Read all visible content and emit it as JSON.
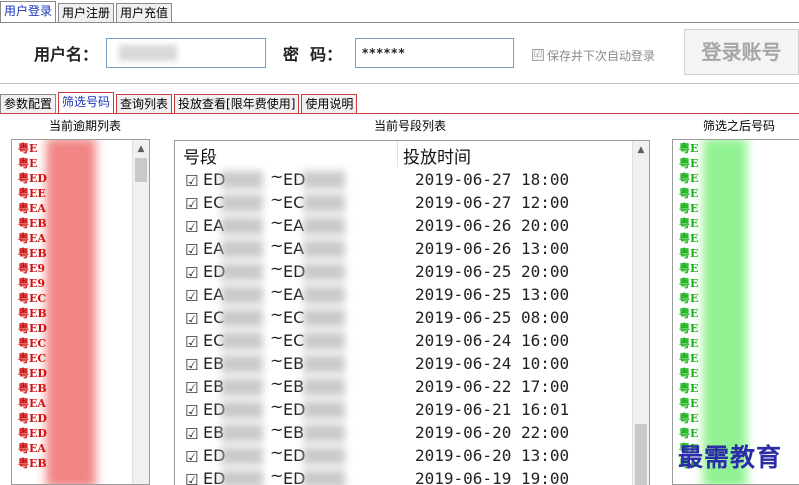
{
  "top_tabs": [
    "用户登录",
    "用户注册",
    "用户充值"
  ],
  "login": {
    "username_label": "用户名：",
    "username_value": "",
    "password_label": "密  码：",
    "password_value": "******",
    "remember_label": "保存并下次自动登录",
    "remember_checked": true,
    "login_button": "登录账号"
  },
  "sub_tabs": [
    "参数配置",
    "筛选号码",
    "查询列表",
    "投放查看[限年费使用]",
    "使用说明"
  ],
  "panes": {
    "left_title": "当前逾期列表",
    "middle_title": "当前号段列表",
    "right_title": "筛选之后号码"
  },
  "left_list": [
    "粤E",
    "粤E",
    "粤ED",
    "粤EE",
    "粤EA",
    "粤EB",
    "粤EA",
    "粤EB",
    "粤E9",
    "粤E9",
    "粤EC",
    "粤EB",
    "粤ED",
    "粤EC",
    "粤EC",
    "粤ED",
    "粤EB",
    "粤EA",
    "粤ED",
    "粤ED",
    "粤EA",
    "粤EB"
  ],
  "right_list": [
    "粤E",
    "粤E",
    "粤E",
    "粤E",
    "粤E",
    "粤E",
    "粤E",
    "粤E",
    "粤E",
    "粤E",
    "粤E",
    "粤E",
    "粤E",
    "粤E",
    "粤E",
    "粤E",
    "粤E",
    "粤E",
    "粤E",
    "粤E",
    "粤E",
    "粤E"
  ],
  "grid": {
    "col_segment": "号段",
    "col_time": "投放时间",
    "rows": [
      {
        "from": "ED",
        "to": "ED",
        "time": "2019-06-27 18:00"
      },
      {
        "from": "EC",
        "to": "EC",
        "time": "2019-06-27 12:00"
      },
      {
        "from": "EA",
        "to": "EA",
        "time": "2019-06-26 20:00"
      },
      {
        "from": "EA",
        "to": "EA",
        "time": "2019-06-26 13:00"
      },
      {
        "from": "ED",
        "to": "ED",
        "time": "2019-06-25 20:00"
      },
      {
        "from": "EA",
        "to": "EA",
        "time": "2019-06-25 13:00"
      },
      {
        "from": "EC",
        "to": "EC",
        "time": "2019-06-25 08:00"
      },
      {
        "from": "EC",
        "to": "EC",
        "time": "2019-06-24 16:00"
      },
      {
        "from": "EB",
        "to": "EB",
        "time": "2019-06-24 10:00"
      },
      {
        "from": "EB",
        "to": "EB",
        "time": "2019-06-22 17:00"
      },
      {
        "from": "ED",
        "to": "ED",
        "time": "2019-06-21 16:01"
      },
      {
        "from": "EB",
        "to": "EB",
        "time": "2019-06-20 22:00"
      },
      {
        "from": "ED",
        "to": "ED",
        "time": "2019-06-20 13:00"
      },
      {
        "from": "ED",
        "to": "ED",
        "time": "2019-06-19 19:00"
      }
    ]
  },
  "watermark": "最需教育",
  "colors": {
    "tab_active_text": "#1a35b8",
    "red_plate": "#d01010",
    "green_plate": "#18b018"
  },
  "icons": {
    "check": "☑",
    "scroll_up": "▲"
  }
}
